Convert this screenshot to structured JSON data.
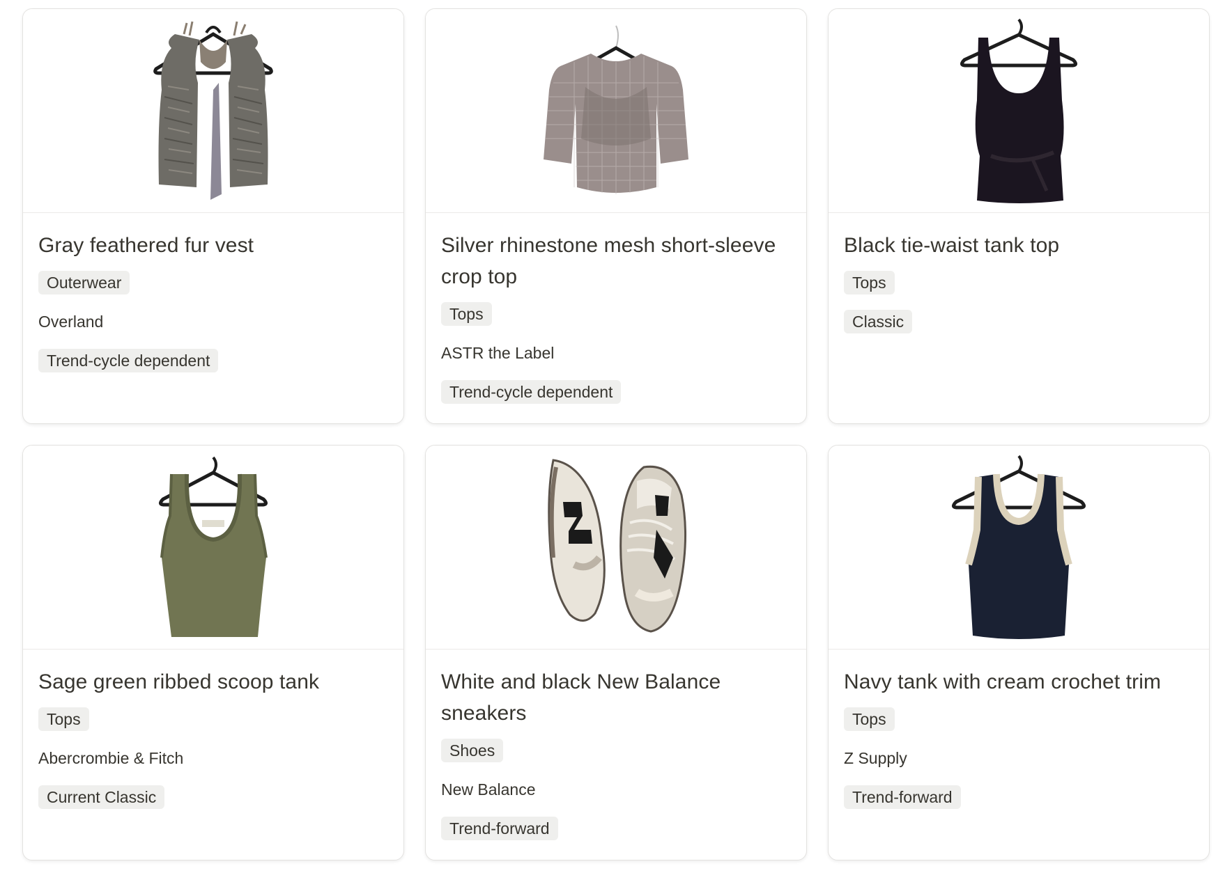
{
  "cards": [
    {
      "title": "Gray feathered fur vest",
      "category": "Outerwear",
      "brand": "Overland",
      "style": "Trend-cycle dependent",
      "image_icon": "fur-vest-image"
    },
    {
      "title": "Silver rhinestone mesh short-sleeve crop top",
      "category": "Tops",
      "brand": "ASTR the Label",
      "style": "Trend-cycle dependent",
      "image_icon": "mesh-crop-top-image"
    },
    {
      "title": "Black tie-waist tank top",
      "category": "Tops",
      "brand": "",
      "style": "Classic",
      "image_icon": "black-tank-image"
    },
    {
      "title": "Sage green ribbed scoop tank",
      "category": "Tops",
      "brand": "Abercrombie & Fitch",
      "style": "Current Classic",
      "image_icon": "sage-tank-image"
    },
    {
      "title": "White and black New Balance sneakers",
      "category": "Shoes",
      "brand": "New Balance",
      "style": "Trend-forward",
      "image_icon": "sneakers-image"
    },
    {
      "title": "Navy tank with cream crochet trim",
      "category": "Tops",
      "brand": "Z Supply",
      "style": "Trend-forward",
      "image_icon": "navy-tank-image"
    }
  ],
  "colors": {
    "tag_bg": "#efefed",
    "text": "#37352f",
    "border": "#e3e2e0"
  }
}
